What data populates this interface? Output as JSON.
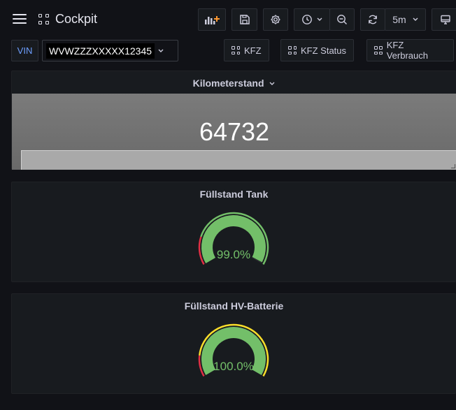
{
  "header": {
    "title": "Cockpit",
    "refresh_interval": "5m"
  },
  "variables": {
    "vin_label": "VIN",
    "vin_value": "WVWZZZXXXXX12345"
  },
  "links": [
    {
      "label": "KFZ"
    },
    {
      "label": "KFZ Status"
    },
    {
      "label": "KFZ Verbrauch"
    }
  ],
  "panels": {
    "kilometerstand": {
      "title": "Kilometerstand",
      "value": "64732"
    },
    "tank": {
      "title": "Füllstand Tank",
      "value": "99.0%",
      "fraction": 0.99
    },
    "battery": {
      "title": "Füllstand HV-Batterie",
      "value": "100.0%",
      "fraction": 1.0
    }
  },
  "colors": {
    "gauge_green": "#73bf69",
    "threshold_red": "#e02f44",
    "threshold_yellow": "#fade2a",
    "accent_blue": "#6e9fff"
  }
}
